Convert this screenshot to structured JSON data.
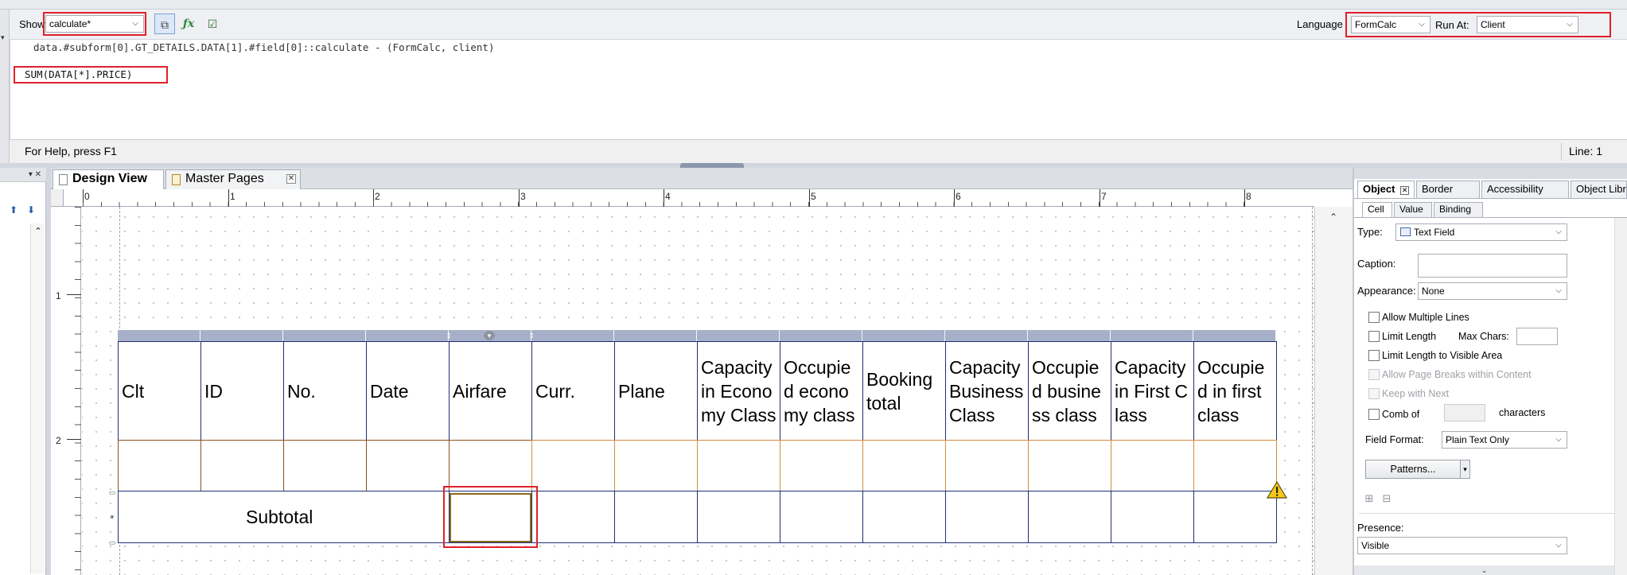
{
  "script_editor": {
    "show_label": "Show:",
    "show_value": "calculate*",
    "language_label": "Language",
    "language_value": "FormCalc",
    "run_at_label": "Run At:",
    "run_at_value": "Client",
    "script_path": "data.#subform[0].GT_DETAILS.DATA[1].#field[0]::calculate - (FormCalc, client)",
    "code": "SUM(DATA[*].PRICE)"
  },
  "statusbar": {
    "help_text": "For Help, press F1",
    "line_text": "Line: 1"
  },
  "design": {
    "tabs": [
      "Design View",
      "Master Pages"
    ],
    "h_ruler": [
      "0",
      "1",
      "2",
      "3",
      "4",
      "5",
      "6",
      "7",
      "8"
    ],
    "v_ruler": [
      "1",
      "2"
    ],
    "table": {
      "headers": [
        "Clt",
        "ID",
        "No.",
        "Date",
        "Airfare",
        "Curr.",
        "Plane",
        "Capacity in Economy Class",
        "Occupied economy class",
        "Booking total",
        "Capacity Business Class",
        "Occupied business class",
        "Capacity in First Class",
        "Occupied in first class"
      ],
      "subtotal_label": "Subtotal"
    }
  },
  "object_palette": {
    "tabs": [
      "Object",
      "Border",
      "Accessibility",
      "Object Library"
    ],
    "subtabs": [
      "Cell",
      "Value",
      "Binding"
    ],
    "type_label": "Type:",
    "type_value": "Text Field",
    "caption_label": "Caption:",
    "appearance_label": "Appearance:",
    "appearance_value": "None",
    "allow_multiple_lines": "Allow Multiple Lines",
    "limit_length": "Limit Length",
    "max_chars_label": "Max Chars:",
    "limit_length_visible": "Limit Length to Visible Area",
    "allow_page_breaks": "Allow Page Breaks within Content",
    "keep_with_next": "Keep with Next",
    "comb_of": "Comb of",
    "characters": "characters",
    "field_format_label": "Field Format:",
    "field_format_value": "Plain Text Only",
    "patterns_button": "Patterns...",
    "presence_label": "Presence:",
    "presence_value": "Visible"
  },
  "colors": {
    "highlight": "#e0202a",
    "table_border": "#1f2f78",
    "column_strip": "#a7b0c9"
  }
}
